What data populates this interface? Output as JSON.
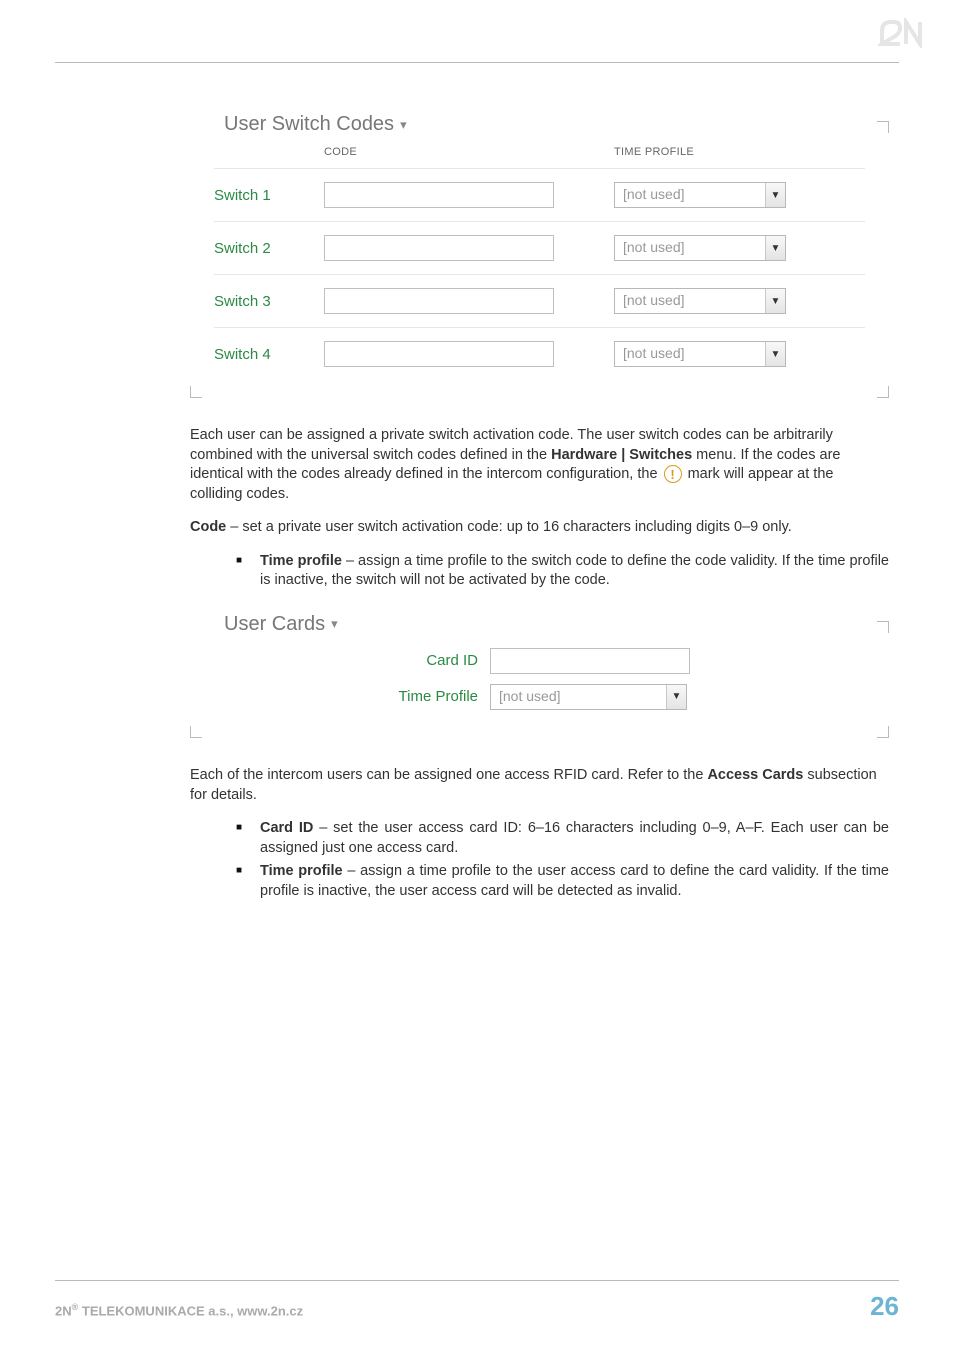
{
  "switchCodes": {
    "legend": "User Switch Codes",
    "headers": {
      "code": "CODE",
      "timeProfile": "TIME PROFILE"
    },
    "rows": [
      {
        "label": "Switch 1",
        "code": "",
        "profile": "[not used]"
      },
      {
        "label": "Switch 2",
        "code": "",
        "profile": "[not used]"
      },
      {
        "label": "Switch 3",
        "code": "",
        "profile": "[not used]"
      },
      {
        "label": "Switch 4",
        "code": "",
        "profile": "[not used]"
      }
    ]
  },
  "text": {
    "p1a": "Each user can be assigned a private switch activation code. The user switch codes can be arbitrarily combined with the universal switch codes defined in the ",
    "p1b": "Hardware | Switches",
    "p1c": " menu. If the codes are identical with the codes already defined in the intercom configuration, the ",
    "p1d": " mark will appear at the colliding codes.",
    "p2a": "Code",
    "p2b": " – set a private user switch activation code: up to 16 characters including digits 0–9 only.",
    "b1a": "Time profile",
    "b1b": " – assign a time profile to the switch code to define the code validity. If the time profile is inactive, the switch will not be activated by the code.",
    "p3a": "Each of the intercom users can be assigned one access RFID card. Refer to the ",
    "p3b": "Access Cards",
    "p3c": " subsection for details.",
    "b2a": "Card ID",
    "b2b": " – set the user access card ID: 6–16 characters including 0–9, A–F. Each user can be assigned just one access card.",
    "b3a": "Time profile",
    "b3b": " – assign a time profile to the user access card to define the card validity. If the time profile is inactive, the user access card will be detected as invalid."
  },
  "userCards": {
    "legend": "User Cards",
    "cardIdLabel": "Card ID",
    "cardIdValue": "",
    "timeProfileLabel": "Time Profile",
    "timeProfileValue": "[not used]"
  },
  "footer": {
    "prefix": "2N",
    "reg": "®",
    "company": " TELEKOMUNIKACE a.s., www.2n.cz",
    "page": "26"
  },
  "warnGlyph": "!"
}
